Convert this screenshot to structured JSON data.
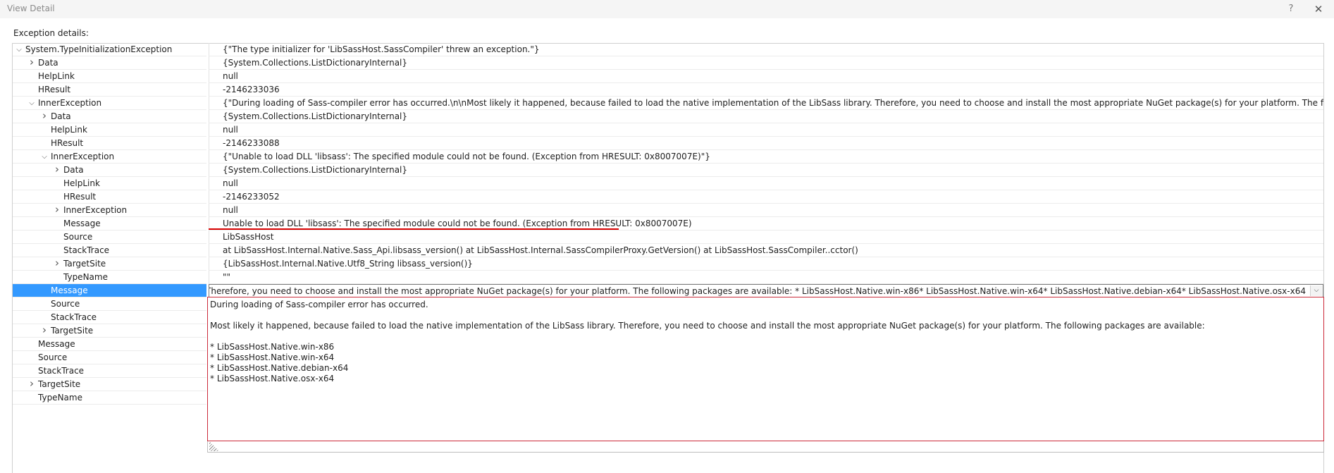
{
  "window": {
    "title": "View Detail",
    "help_glyph": "?",
    "close_glyph": "✕"
  },
  "exception_label": "Exception details:",
  "icons": {
    "expanded": "⌵",
    "collapsed": "›",
    "dropdown": "⌵"
  },
  "rows": [
    {
      "name": "System.TypeInitializationException",
      "value": "{\"The type initializer for 'LibSassHost.SassCompiler' threw an exception.\"}"
    },
    {
      "name": "Data",
      "value": "{System.Collections.ListDictionaryInternal}"
    },
    {
      "name": "HelpLink",
      "value": "null"
    },
    {
      "name": "HResult",
      "value": "-2146233036"
    },
    {
      "name": "InnerException",
      "value": "{\"During loading of Sass-compiler error has occurred.\\n\\nMost likely it happened, because failed to load the native implementation of the LibSass library. Therefore, you need to choose and install the most appropriate NuGet package(s) for your platform. The following packages are available:\\n\\n* Lib"
    },
    {
      "name": "Data",
      "value": "{System.Collections.ListDictionaryInternal}"
    },
    {
      "name": "HelpLink",
      "value": "null"
    },
    {
      "name": "HResult",
      "value": "-2146233088"
    },
    {
      "name": "InnerException",
      "value": "{\"Unable to load DLL 'libsass': The specified module could not be found. (Exception from HRESULT: 0x8007007E)\"}"
    },
    {
      "name": "Data",
      "value": "{System.Collections.ListDictionaryInternal}"
    },
    {
      "name": "HelpLink",
      "value": "null"
    },
    {
      "name": "HResult",
      "value": "-2146233052"
    },
    {
      "name": "InnerException",
      "value": "null"
    },
    {
      "name": "Message",
      "value": "Unable to load DLL 'libsass': The specified module could not be found. (Exception from HRESULT: 0x8007007E)"
    },
    {
      "name": "Source",
      "value": "LibSassHost"
    },
    {
      "name": "StackTrace",
      "value": "   at LibSassHost.Internal.Native.Sass_Api.libsass_version()   at LibSassHost.Internal.SassCompilerProxy.GetVersion()   at LibSassHost.SassCompiler..cctor()"
    },
    {
      "name": "TargetSite",
      "value": "{LibSassHost.Internal.Native.Utf8_String libsass_version()}"
    },
    {
      "name": "TypeName",
      "value": "\"\""
    },
    {
      "name": "Message",
      "value": "e implementation of the LibSass library. Therefore, you need to choose and install the most appropriate NuGet package(s) for your platform. The following packages are available: * LibSassHost.Native.win-x86* LibSassHost.Native.win-x64* LibSassHost.Native.debian-x64* LibSassHost.Native.osx-x64"
    },
    {
      "name": "Source",
      "value": ""
    },
    {
      "name": "StackTrace",
      "value": ""
    },
    {
      "name": "TargetSite",
      "value": ""
    },
    {
      "name": "Message",
      "value": ""
    },
    {
      "name": "Source",
      "value": ""
    },
    {
      "name": "StackTrace",
      "value": ""
    },
    {
      "name": "TargetSite",
      "value": ""
    },
    {
      "name": "TypeName",
      "value": ""
    }
  ],
  "popup": {
    "lines": [
      "During loading of Sass-compiler error has occurred.",
      "",
      "Most likely it happened, because failed to load the native implementation of the LibSass library. Therefore, you need to choose and install the most appropriate NuGet package(s) for your platform. The following packages are available:",
      "",
      "* LibSassHost.Native.win-x86",
      "* LibSassHost.Native.win-x64",
      "* LibSassHost.Native.debian-x64",
      "* LibSassHost.Native.osx-x64"
    ]
  },
  "colors": {
    "selection": "#3399ff",
    "highlight_border": "#cc2a3a",
    "underline": "#d80000"
  }
}
